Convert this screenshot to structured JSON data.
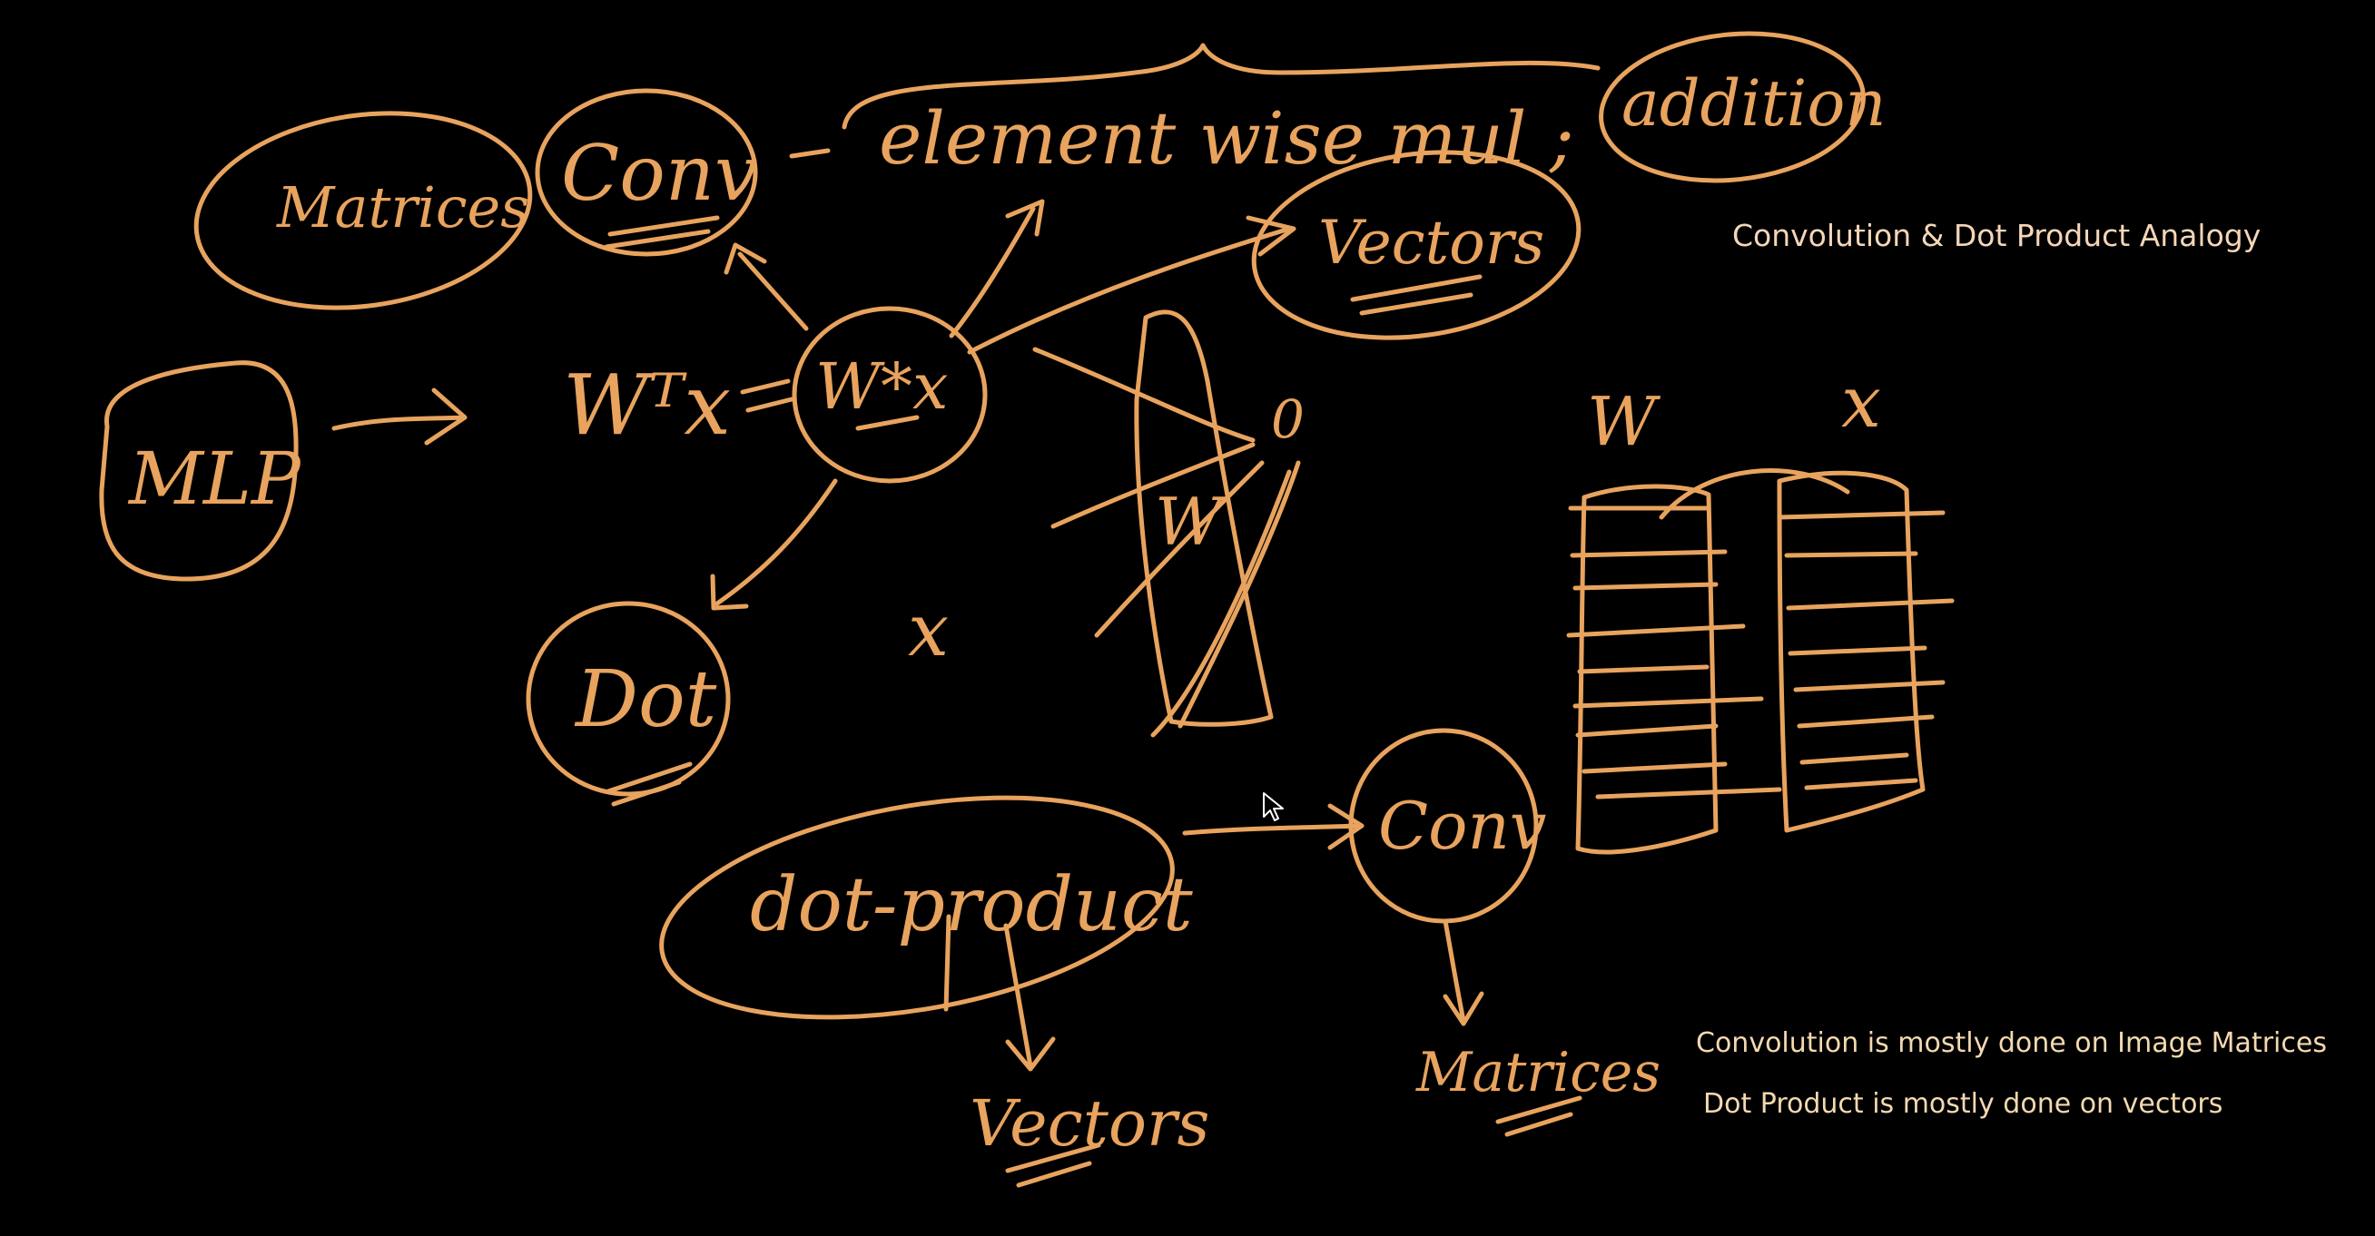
{
  "board": {
    "ink_color": "#e8a35e",
    "background": "#000000",
    "text_color": "#f3d9b0"
  },
  "handwriting": {
    "matrices": "Matrices",
    "conv_top": "Conv",
    "elementwise": "element wise mul ;",
    "addition": "addition",
    "vectors_top": "Vectors",
    "mlp": "MLP",
    "wtx": "Wᵀx",
    "wx": "W*x",
    "x_mid": "x",
    "dot": "Dot",
    "w_vec": "W",
    "dot_product": "dot-product",
    "conv_bottom": "Conv",
    "vectors_bottom": "Vectors",
    "matrices_bottom": "Matrices",
    "w_label": "W",
    "x_label": "x",
    "zero": "0"
  },
  "typed_text": {
    "title": "Convolution & Dot Product Analogy",
    "note_1": "Convolution is mostly done on Image Matrices",
    "note_2": "Dot Product is mostly done on vectors"
  },
  "icons": {
    "cursor": "mouse-pointer-icon"
  }
}
